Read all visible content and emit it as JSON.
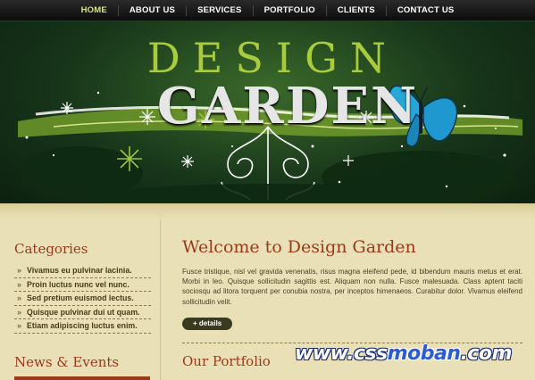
{
  "nav": {
    "items": [
      {
        "label": "HOME"
      },
      {
        "label": "ABOUT US"
      },
      {
        "label": "SERVICES"
      },
      {
        "label": "PORTFOLIO"
      },
      {
        "label": "CLIENTS"
      },
      {
        "label": "CONTACT US"
      }
    ],
    "active_color": "#d9e38a"
  },
  "header": {
    "logo_top": "DESIGN",
    "logo_bottom": "GARDEN",
    "accent_color": "#a9cc3c"
  },
  "sidebar": {
    "categories_title": "Categories",
    "categories": [
      "Vivamus eu pulvinar lacinia.",
      "Proin luctus nunc vel nunc.",
      "Sed pretium euismod lectus.",
      "Quisque pulvinar dui ut quam.",
      "Etiam adipiscing luctus enim."
    ],
    "news_title": "News & Events"
  },
  "main": {
    "welcome_title": "Welcome to Design Garden",
    "welcome_text": "Fusce tristique, nisl vel gravida venenatis, risus magna eleifend pede, id bibendum mauris metus et erat. Morbi in leo. Quisque sollicitudin sagittis est. Aliquam non nulla. Fusce malesuada. Class aptent taciti sociosqu ad litora torquent per conubia nostra, per inceptos himenaeos. Curabitur dolor. Vivamus eleifend sollicitudin velit.",
    "details_label": "+ details",
    "portfolio_title": "Our Portfolio"
  },
  "watermark": {
    "part1": "www.css",
    "part2": "moban",
    "part3": ".com"
  },
  "colors": {
    "heading": "#9a3a1a",
    "background": "#e9e0b8",
    "header_dark": "#17351a"
  }
}
